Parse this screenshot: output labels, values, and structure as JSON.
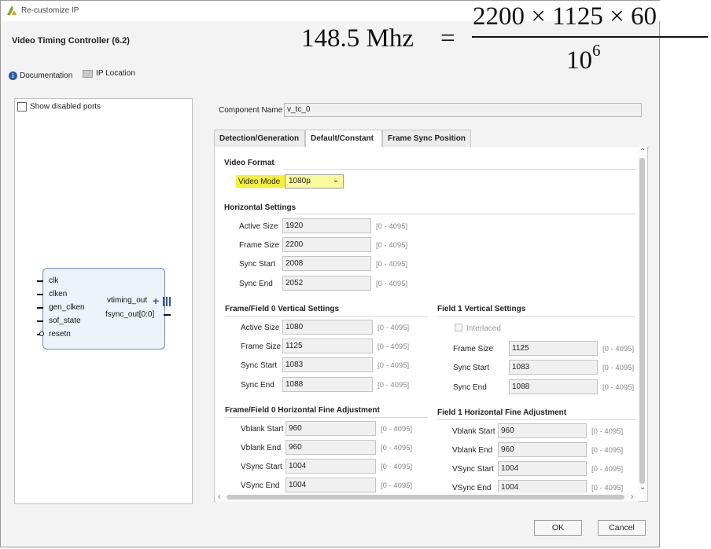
{
  "window": {
    "title": "Re-customize IP"
  },
  "ip_name": "Video Timing Controller (6.2)",
  "links": {
    "documentation": "Documentation",
    "ip_location": "IP Location"
  },
  "left_panel": {
    "show_disabled_ports": "Show disabled ports",
    "block": {
      "inputs": [
        "clk",
        "clken",
        "gen_clken",
        "sof_state",
        "resetn"
      ],
      "outputs": [
        "vtiming_out",
        "fsync_out[0:0]"
      ],
      "expand_symbol": "+"
    }
  },
  "component_name": {
    "label": "Component Name",
    "value": "v_tc_0"
  },
  "tabs": [
    {
      "label": "Detection/Generation",
      "active": false
    },
    {
      "label": "Default/Constant",
      "active": true
    },
    {
      "label": "Frame Sync Position",
      "active": false
    }
  ],
  "video_format": {
    "title": "Video Format",
    "label": "Video Mode",
    "value": "1080p"
  },
  "horizontal": {
    "title": "Horizontal Settings",
    "rows": [
      {
        "label": "Active Size",
        "value": "1920",
        "range": "[0 - 4095]"
      },
      {
        "label": "Frame Size",
        "value": "2200",
        "range": "[0 - 4095]"
      },
      {
        "label": "Sync Start",
        "value": "2008",
        "range": "[0 - 4095]"
      },
      {
        "label": "Sync End",
        "value": "2052",
        "range": "[0 - 4095]"
      }
    ]
  },
  "field0_vertical": {
    "title": "Frame/Field 0 Vertical Settings",
    "rows": [
      {
        "label": "Active Size",
        "value": "1080",
        "range": "[0 - 4095]"
      },
      {
        "label": "Frame Size",
        "value": "1125",
        "range": "[0 - 4095]"
      },
      {
        "label": "Sync Start",
        "value": "1083",
        "range": "[0 - 4095]"
      },
      {
        "label": "Sync End",
        "value": "1088",
        "range": "[0 - 4095]"
      }
    ]
  },
  "field1_vertical": {
    "title": "Field 1 Vertical Settings",
    "interlaced": "Interlaced",
    "rows": [
      {
        "label": "Frame Size",
        "value": "1125",
        "range": "[0 - 4095]"
      },
      {
        "label": "Sync Start",
        "value": "1083",
        "range": "[0 - 4095]"
      },
      {
        "label": "Sync End",
        "value": "1088",
        "range": "[0 - 4095]"
      }
    ]
  },
  "field0_fine": {
    "title": "Frame/Field 0 Horizontal Fine Adjustment",
    "rows": [
      {
        "label": "Vblank Start",
        "value": "960",
        "range": "[0 - 4095]"
      },
      {
        "label": "Vblank End",
        "value": "960",
        "range": "[0 - 4095]"
      },
      {
        "label": "VSync Start",
        "value": "1004",
        "range": "[0 - 4095]"
      },
      {
        "label": "VSync End",
        "value": "1004",
        "range": "[0 - 4095]"
      }
    ]
  },
  "field1_fine": {
    "title": "Field 1 Horizontal Fine Adjustment",
    "rows": [
      {
        "label": "Vblank Start",
        "value": "960",
        "range": "[0 - 4095]"
      },
      {
        "label": "Vblank End",
        "value": "960",
        "range": "[0 - 4095]"
      },
      {
        "label": "VSync Start",
        "value": "1004",
        "range": "[0 - 4095]"
      },
      {
        "label": "VSync End",
        "value": "1004",
        "range": "[0 - 4095]"
      }
    ]
  },
  "buttons": {
    "ok": "OK",
    "cancel": "Cancel"
  },
  "formula": {
    "lhs": "148.5 Mhz",
    "equals": "=",
    "numerator": "2200 × 1125 × 60",
    "denominator_base": "10",
    "denominator_exp": "6"
  },
  "colors": {
    "highlight": "#f4f03a",
    "block_fill": "#eef3fa",
    "block_border": "#6f8cb8"
  }
}
